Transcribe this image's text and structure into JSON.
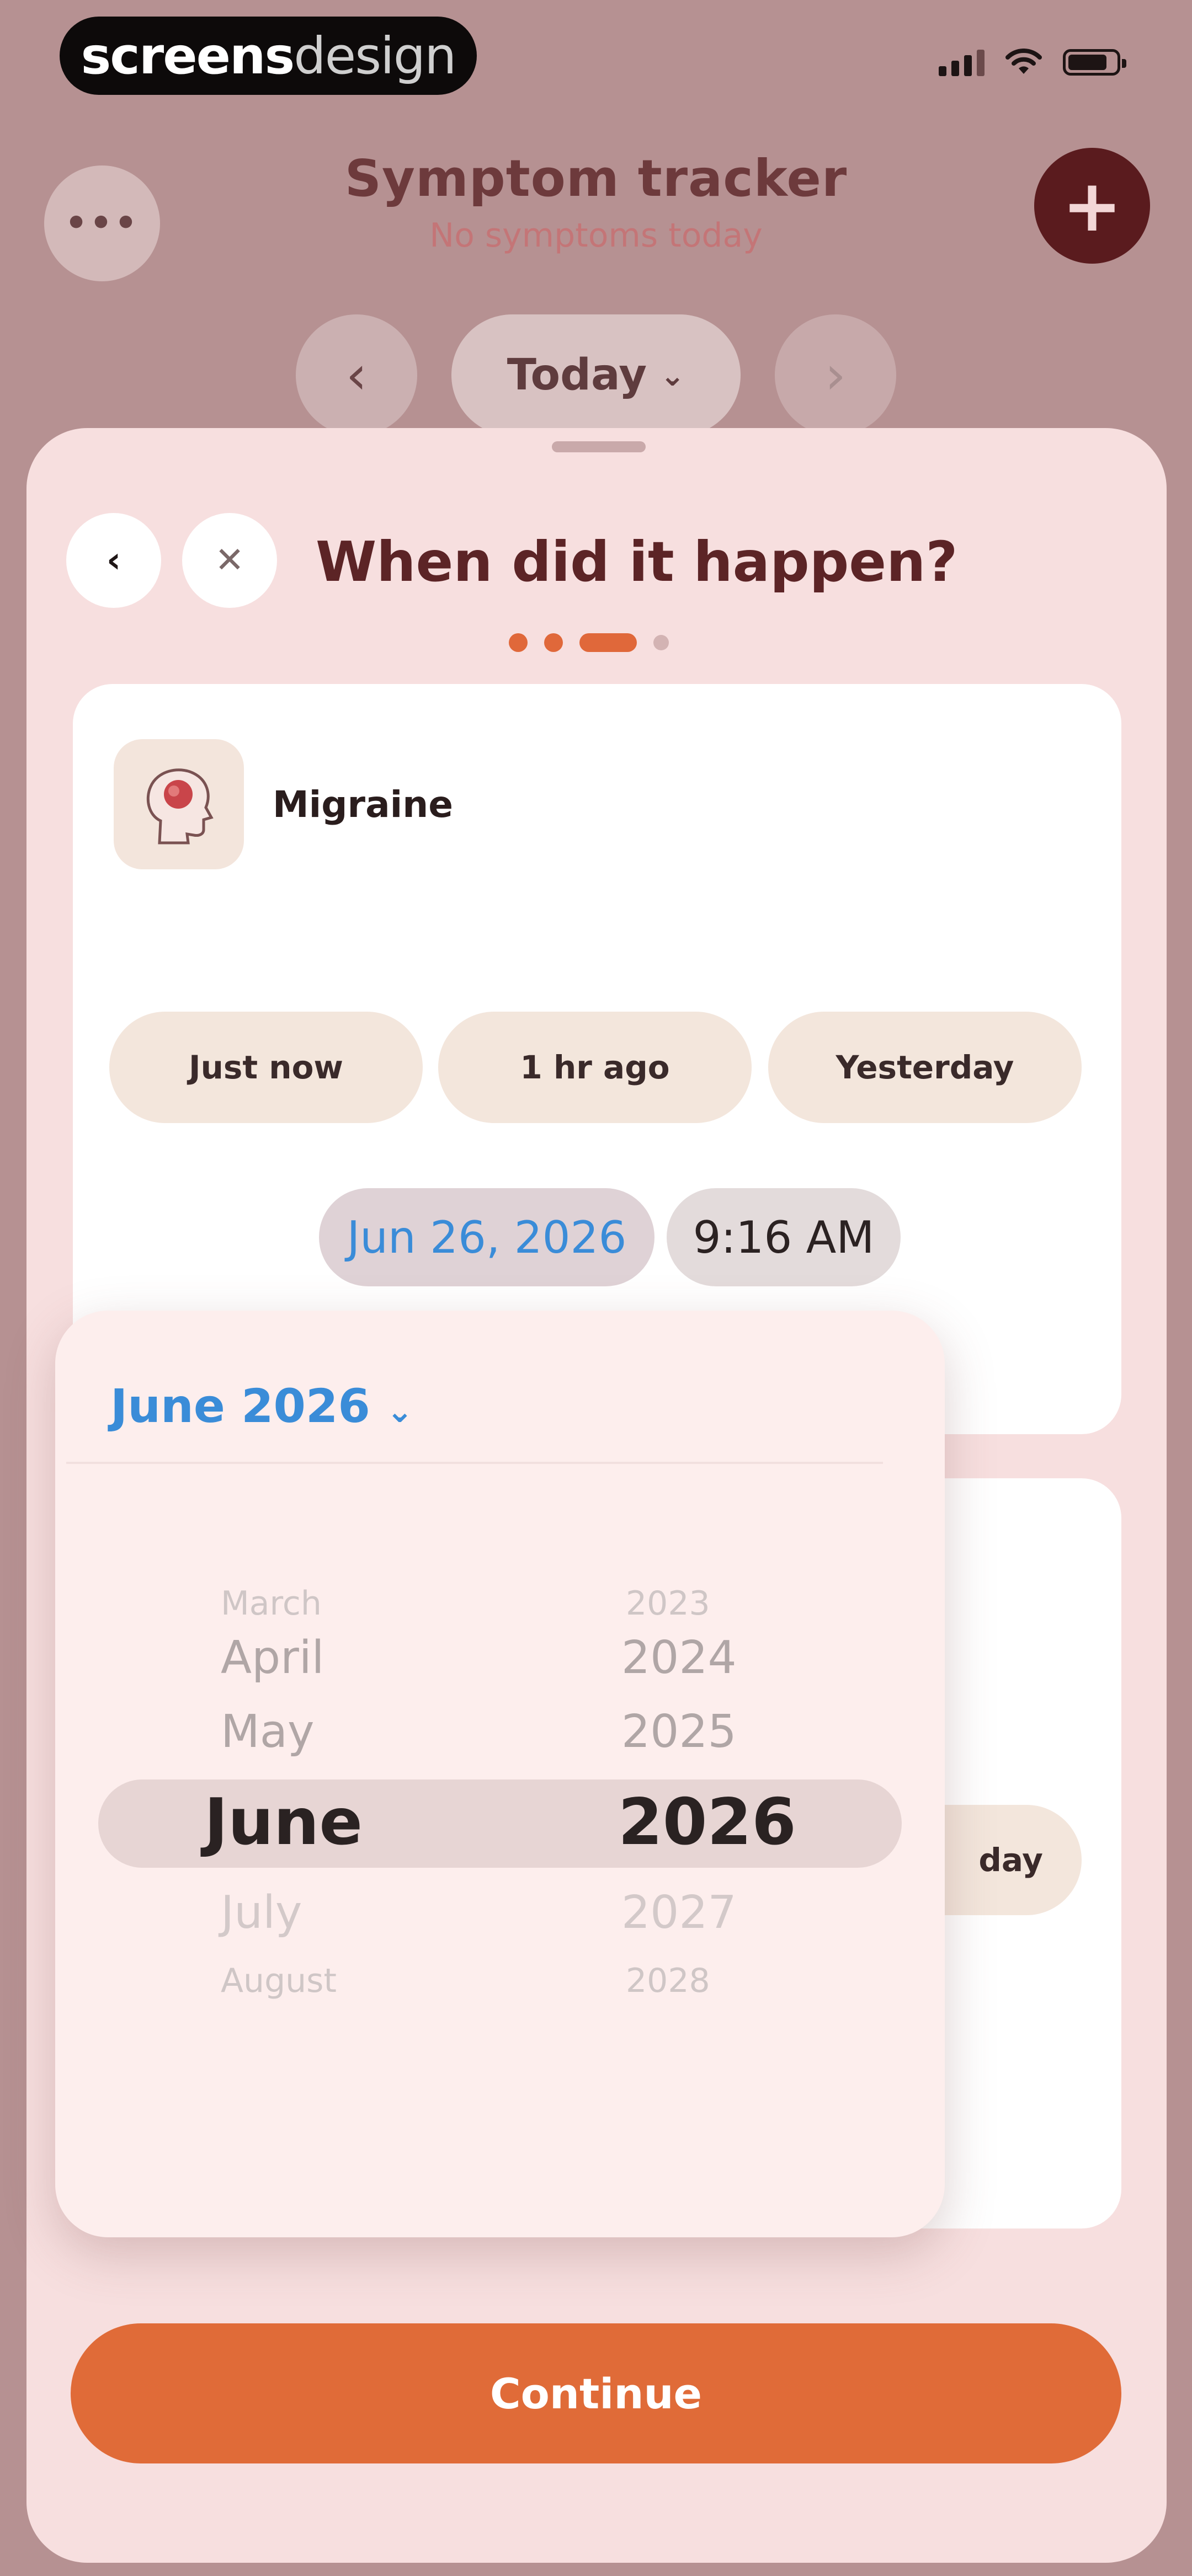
{
  "status_bar": {
    "brand_part1": "screens",
    "brand_part2": "design",
    "icons": [
      "signal-icon",
      "wifi-icon",
      "battery-icon"
    ]
  },
  "header": {
    "title": "Symptom tracker",
    "subtitle": "No symptoms today",
    "menu_glyph": "•••",
    "add_glyph": "+",
    "prev_glyph": "‹",
    "next_glyph": "›",
    "day_label": "Today",
    "day_chevron": "⌄"
  },
  "sheet": {
    "back_glyph": "‹",
    "close_glyph": "✕",
    "title": "When did it happen?",
    "progress": {
      "step": 3,
      "total": 4
    }
  },
  "symptom_card": {
    "name": "Migraine",
    "quick_options": [
      "Just now",
      "1 hr ago",
      "Yesterday"
    ],
    "date": "Jun 26, 2026",
    "time": "9:16 AM"
  },
  "second_card": {
    "chip_label": "day"
  },
  "date_picker": {
    "header": "June 2026",
    "header_chevron": "⌄",
    "months": [
      "March",
      "April",
      "May",
      "June",
      "July",
      "August"
    ],
    "years": [
      "2023",
      "2024",
      "2025",
      "2026",
      "2027",
      "2028"
    ],
    "selected_month": "June",
    "selected_year": "2026"
  },
  "footer": {
    "continue_label": "Continue"
  },
  "colors": {
    "background": "#b69192",
    "sheet": "#f7dfdf",
    "accent": "#e06b38",
    "link_blue": "#3a8cd8",
    "dark_maroon": "#5a1b1e"
  }
}
